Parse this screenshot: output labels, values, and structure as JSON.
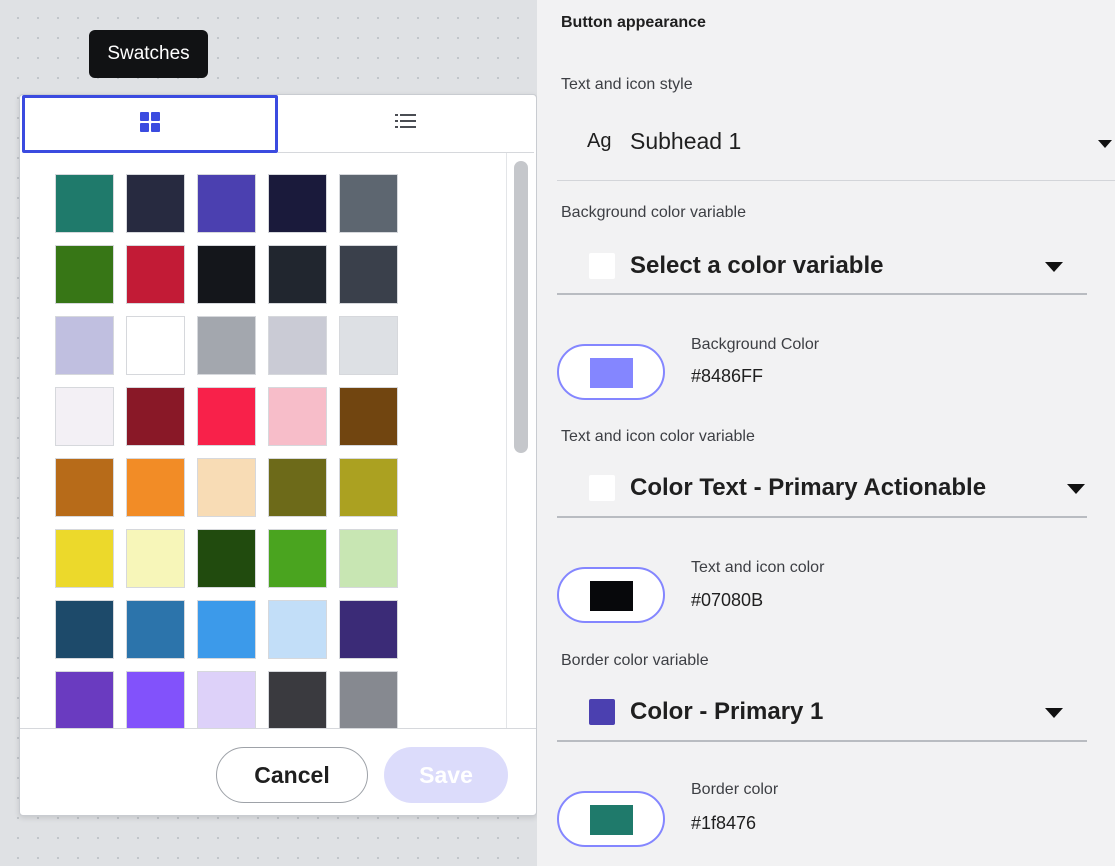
{
  "picker": {
    "tooltip": "Swatches",
    "tabs": [
      {
        "icon": "grid-icon",
        "active": true
      },
      {
        "icon": "list-icon",
        "active": false
      }
    ],
    "swatches": [
      "#1f7a6b",
      "#272a40",
      "#4b40b0",
      "#1a1a3b",
      "#5d6670",
      "#377616",
      "#c21b36",
      "#14161b",
      "#21262f",
      "#3a404b",
      "#c0bfe0",
      "#ffffff",
      "#a3a7ae",
      "#cacbd5",
      "#dde0e4",
      "#f3f0f5",
      "#891827",
      "#f8214a",
      "#f7bdc9",
      "#714510",
      "#b76b19",
      "#f28c26",
      "#f8dcb5",
      "#6d6a19",
      "#aba121",
      "#ecd92b",
      "#f7f6b9",
      "#214b0e",
      "#4aa41f",
      "#c8e6b3",
      "#1d4a6a",
      "#2c74ab",
      "#3c9aea",
      "#c2def8",
      "#3b2b77",
      "#6a3bc0",
      "#8252fb",
      "#ddd1f9",
      "#3a3a3f",
      "#868990"
    ],
    "cancel_label": "Cancel",
    "save_label": "Save"
  },
  "panel": {
    "section_title": "Button appearance",
    "text_style": {
      "label": "Text and icon style",
      "prefix": "Ag",
      "value": "Subhead 1"
    },
    "bg_variable": {
      "label": "Background color variable",
      "value": "Select a color variable",
      "chip_color": "#ffffff"
    },
    "bg_color": {
      "label": "Background Color",
      "hex": "#8486FF",
      "swatch": "#8486ff"
    },
    "text_variable": {
      "label": "Text and icon color variable",
      "value": "Color Text - Primary Actionable",
      "chip_color": "#ffffff"
    },
    "text_color": {
      "label": "Text and icon color",
      "hex": "#07080B",
      "swatch": "#07080b"
    },
    "border_variable": {
      "label": "Border color variable",
      "value": "Color - Primary 1",
      "chip_color": "#4b40b0"
    },
    "border_color": {
      "label": "Border color",
      "hex": "#1f8476",
      "swatch": "#1f7a6b"
    }
  }
}
